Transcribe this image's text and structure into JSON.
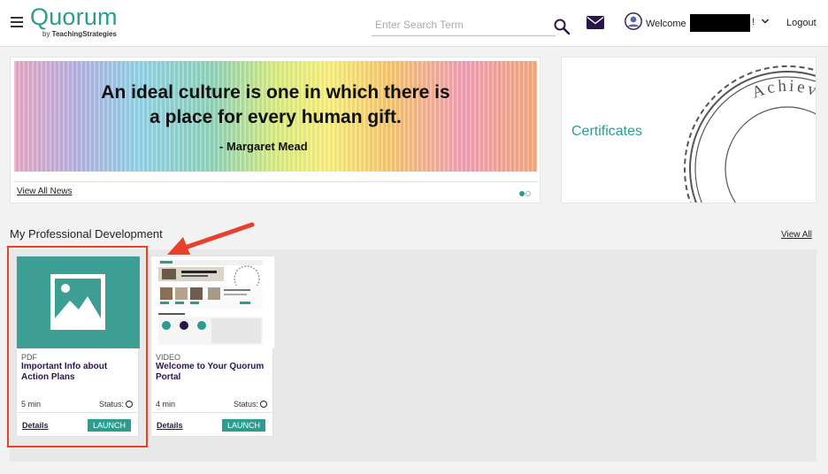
{
  "header": {
    "logo": "Quorum",
    "logo_sub_prefix": "by ",
    "logo_sub_brand": "TeachingStrategies",
    "search_placeholder": "Enter Search Term",
    "welcome": "Welcome",
    "welcome_suffix": "!",
    "logout": "Logout"
  },
  "news": {
    "quote_line1": "An ideal culture is one in which there is",
    "quote_line2": "a place for every human gift.",
    "quote_author": "- Margaret Mead",
    "view_all": "View All News"
  },
  "certificates": {
    "label": "Certificates",
    "seal_text": "Achievement · Ex"
  },
  "pd": {
    "title": "My Professional Development",
    "view_all": "View All",
    "courses": [
      {
        "type": "PDF",
        "title": "Important Info about Action Plans",
        "duration": "5 min",
        "status_label": "Status:",
        "details": "Details",
        "launch": "LAUNCH"
      },
      {
        "type": "VIDEO",
        "title": "Welcome to Your Quorum Portal",
        "duration": "4 min",
        "status_label": "Status:",
        "details": "Details",
        "launch": "LAUNCH"
      }
    ]
  },
  "colors": {
    "accent": "#2a9d8f",
    "brand_dark": "#2b1747",
    "highlight": "#e8402a"
  }
}
